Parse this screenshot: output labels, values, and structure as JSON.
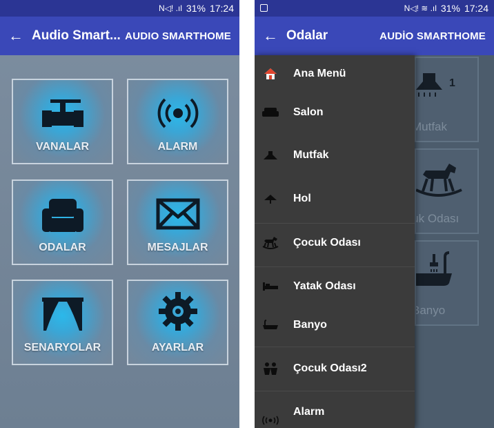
{
  "left_screen": {
    "status": {
      "signal_glyphs": "N◁! .ıl",
      "battery": "31%",
      "time": "17:24"
    },
    "app_bar": {
      "title": "Audio Smart...",
      "action": "AUDIO SMARTHOME"
    },
    "tiles": [
      {
        "label": "VANALAR",
        "icon": "valve-icon"
      },
      {
        "label": "ALARM",
        "icon": "alarm-icon"
      },
      {
        "label": "ODALAR",
        "icon": "armchair-icon"
      },
      {
        "label": "MESAJLAR",
        "icon": "envelope-icon"
      },
      {
        "label": "SENARYOLAR",
        "icon": "curtain-icon"
      },
      {
        "label": "AYARLAR",
        "icon": "gear-icon"
      }
    ]
  },
  "right_screen": {
    "status": {
      "signal_glyphs": "N◁! ≋ .ıl",
      "battery": "31%",
      "time": "17:24"
    },
    "app_bar": {
      "title": "Odalar",
      "action": "AUDİO SMARTHOME"
    },
    "background_tiles": [
      {
        "label": "Mutfak",
        "badge": "1",
        "icon": "range-hood-icon"
      },
      {
        "label": "Çocuk Odası",
        "icon": "rocking-horse-icon"
      },
      {
        "label": "Banyo",
        "icon": "bathtub-icon"
      }
    ],
    "drawer_items": [
      {
        "label": "Ana Menü",
        "icon": "home-icon"
      },
      {
        "label": "Salon",
        "icon": "sofa-icon"
      },
      {
        "label": "Mutfak",
        "icon": "range-hood-icon"
      },
      {
        "label": "Hol",
        "icon": "hall-icon"
      },
      {
        "label": "Çocuk Odası",
        "icon": "rocking-horse-icon"
      },
      {
        "label": "Yatak Odası",
        "icon": "bed-icon"
      },
      {
        "label": "Banyo",
        "icon": "bathtub-icon"
      },
      {
        "label": "Çocuk Odası2",
        "icon": "kids-icon"
      },
      {
        "label": "Alarm",
        "icon": "alarm-icon"
      }
    ]
  },
  "colors": {
    "status_bar": "#2b3594",
    "app_bar": "#3a48b8",
    "tile_glow": "#2bb8ea",
    "drawer_bg": "#3b3b3b"
  }
}
